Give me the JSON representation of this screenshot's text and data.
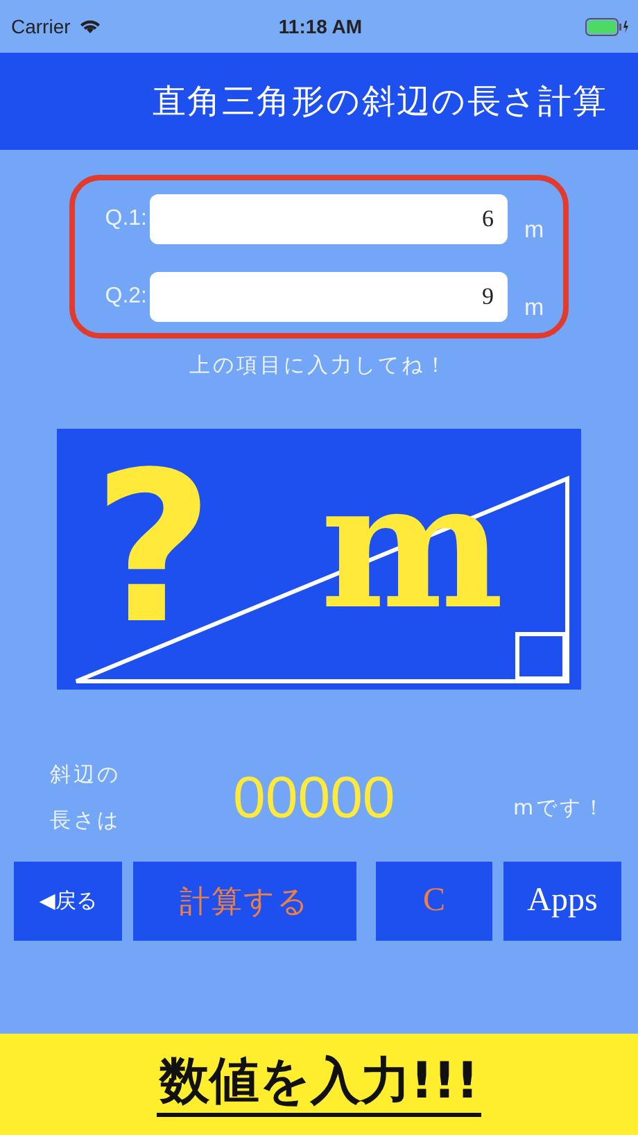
{
  "status_bar": {
    "carrier": "Carrier",
    "time": "11:18 AM"
  },
  "header": {
    "title": "直角三角形の斜辺の長さ計算"
  },
  "fields": [
    {
      "label": "Q.1:",
      "value": "6",
      "unit": "m"
    },
    {
      "label": "Q.2:",
      "value": "9",
      "unit": "m"
    }
  ],
  "hint": "上の項目に入力してね！",
  "banner": {
    "symbol": "?",
    "unit": "m"
  },
  "result": {
    "label_lines": [
      "斜辺の",
      "長さは"
    ],
    "value": "00000",
    "suffix": "mです！"
  },
  "buttons": [
    {
      "label": "◀戻る",
      "kind": "back"
    },
    {
      "label": "計算する",
      "kind": "calculate"
    },
    {
      "label": "C",
      "kind": "clear"
    },
    {
      "label": "Apps",
      "kind": "apps"
    }
  ],
  "caption": "数値を入力!!!"
}
